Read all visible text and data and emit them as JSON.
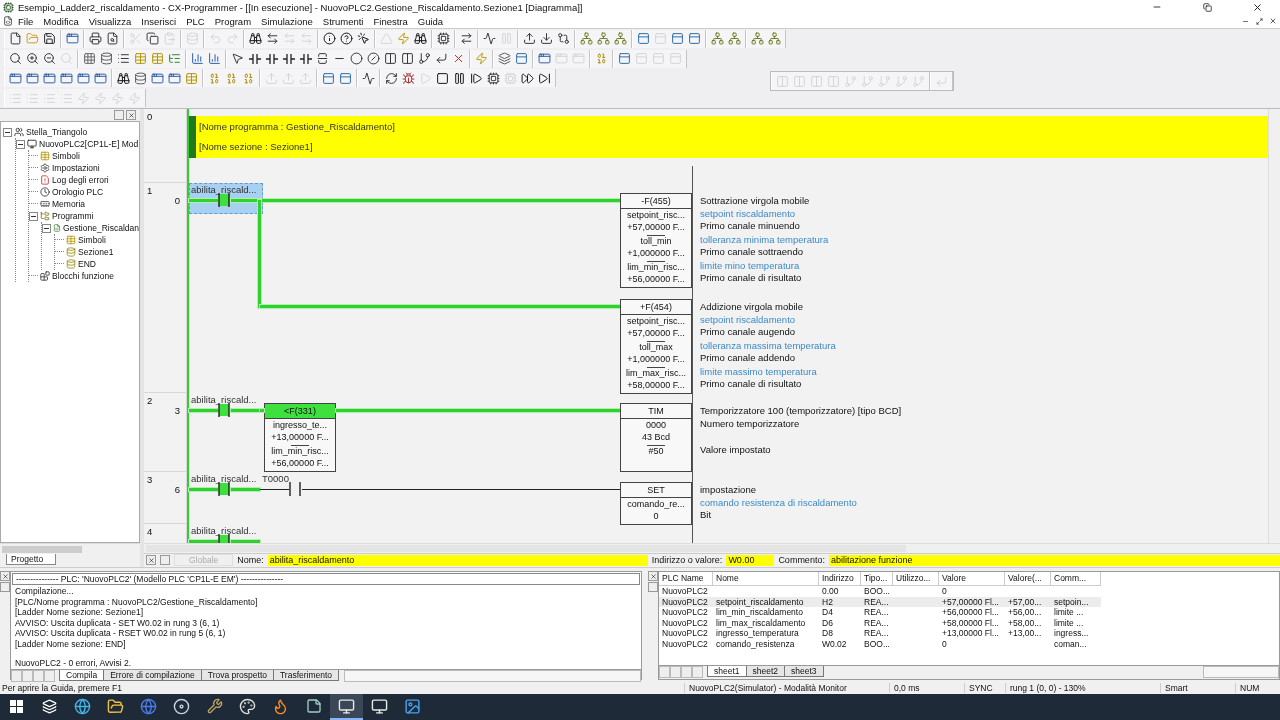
{
  "window": {
    "title": "Esempio_Ladder2_riscaldamento - CX-Programmer - [[In esecuzione] - NuovoPLC2.Gestione_Riscaldamento.Sezione1 [Diagramma]]"
  },
  "menu": [
    "File",
    "Modifica",
    "Visualizza",
    "Inserisci",
    "PLC",
    "Program",
    "Simulazione",
    "Strumenti",
    "Finestra",
    "Guida"
  ],
  "toolbars": [
    {
      "groups": [
        [
          {
            "kind": "new",
            "disabled": false
          },
          {
            "kind": "open",
            "disabled": false
          },
          {
            "kind": "save",
            "disabled": false
          }
        ],
        [
          {
            "kind": "window",
            "disabled": false
          }
        ],
        [
          {
            "kind": "print",
            "disabled": false
          },
          {
            "kind": "preview",
            "disabled": false
          }
        ],
        [
          {
            "kind": "cut",
            "disabled": true
          },
          {
            "kind": "copy",
            "disabled": false
          },
          {
            "kind": "paste",
            "disabled": true
          }
        ],
        [
          {
            "kind": "db",
            "disabled": true
          }
        ],
        [
          {
            "kind": "undo",
            "disabled": true
          },
          {
            "kind": "redo",
            "disabled": true
          }
        ],
        [
          {
            "kind": "find",
            "disabled": false
          },
          {
            "kind": "swap",
            "disabled": false
          },
          {
            "kind": "swap",
            "disabled": true
          },
          {
            "kind": "swap",
            "disabled": true
          }
        ],
        [
          {
            "kind": "info",
            "disabled": false
          },
          {
            "kind": "help",
            "disabled": false
          },
          {
            "kind": "pointerhelp",
            "disabled": false
          }
        ],
        [
          {
            "kind": "warn",
            "disabled": true
          },
          {
            "kind": "bolt",
            "disabled": false
          },
          {
            "kind": "find",
            "disabled": false
          }
        ],
        [
          {
            "kind": "chip",
            "disabled": false
          }
        ],
        [
          {
            "kind": "transfer",
            "disabled": false
          }
        ],
        [
          {
            "kind": "monitor",
            "disabled": false
          },
          {
            "kind": "pause",
            "disabled": true
          }
        ],
        [
          {
            "kind": "upload",
            "disabled": false
          },
          {
            "kind": "download",
            "disabled": false
          },
          {
            "kind": "compare",
            "disabled": false
          }
        ],
        [
          {
            "kind": "net",
            "disabled": false
          },
          {
            "kind": "net",
            "disabled": false
          },
          {
            "kind": "net",
            "disabled": false
          }
        ],
        [
          {
            "kind": "panel",
            "disabled": false
          },
          {
            "kind": "panel",
            "disabled": true
          },
          {
            "kind": "panel",
            "disabled": false
          },
          {
            "kind": "panel",
            "disabled": false
          }
        ],
        [
          {
            "kind": "net",
            "disabled": false
          },
          {
            "kind": "net",
            "disabled": false
          }
        ],
        [
          {
            "kind": "net",
            "disabled": false
          },
          {
            "kind": "net",
            "disabled": false
          }
        ]
      ]
    },
    {
      "groups": [
        [
          {
            "kind": "search",
            "disabled": false
          },
          {
            "kind": "zoomin",
            "disabled": false
          },
          {
            "kind": "zoomout",
            "disabled": false
          },
          {
            "kind": "search",
            "disabled": true
          }
        ],
        [
          {
            "kind": "grid",
            "disabled": false
          },
          {
            "kind": "db",
            "disabled": false
          },
          {
            "kind": "list",
            "disabled": false
          },
          {
            "kind": "table",
            "disabled": false
          },
          {
            "kind": "table",
            "disabled": false
          },
          {
            "kind": "tree",
            "disabled": false
          }
        ],
        [
          {
            "kind": "chart",
            "disabled": false
          },
          {
            "kind": "chart",
            "disabled": false
          }
        ],
        [
          {
            "kind": "pointer",
            "disabled": false
          },
          {
            "kind": "contact",
            "disabled": false
          },
          {
            "kind": "contact",
            "disabled": false
          },
          {
            "kind": "contact",
            "disabled": false
          },
          {
            "kind": "contact",
            "disabled": false
          },
          {
            "kind": "vline",
            "disabled": false
          },
          {
            "kind": "line",
            "disabled": false
          },
          {
            "kind": "coil",
            "disabled": false
          },
          {
            "kind": "coilnc",
            "disabled": false
          },
          {
            "kind": "block",
            "disabled": false
          },
          {
            "kind": "block",
            "disabled": false
          },
          {
            "kind": "branch",
            "disabled": false
          },
          {
            "kind": "corner",
            "disabled": false
          },
          {
            "kind": "del",
            "disabled": false
          }
        ],
        [
          {
            "kind": "bolt",
            "disabled": false
          }
        ],
        [
          {
            "kind": "layers",
            "disabled": false
          },
          {
            "kind": "panel",
            "disabled": false
          }
        ],
        [
          {
            "kind": "window",
            "disabled": false
          },
          {
            "kind": "window",
            "disabled": true
          },
          {
            "kind": "window",
            "disabled": true
          }
        ],
        [
          {
            "kind": "binary",
            "disabled": false
          }
        ],
        [
          {
            "kind": "panel",
            "disabled": false
          },
          {
            "kind": "panel",
            "disabled": true
          },
          {
            "kind": "panel",
            "disabled": true
          },
          {
            "kind": "panel",
            "disabled": true
          }
        ]
      ]
    },
    {
      "groups": [
        [
          {
            "kind": "window",
            "disabled": false
          },
          {
            "kind": "window",
            "disabled": false
          },
          {
            "kind": "window",
            "disabled": false
          },
          {
            "kind": "window",
            "disabled": false
          },
          {
            "kind": "window",
            "disabled": false
          },
          {
            "kind": "window",
            "disabled": false
          }
        ],
        [
          {
            "kind": "find",
            "disabled": false
          },
          {
            "kind": "db",
            "disabled": false
          },
          {
            "kind": "window",
            "disabled": false
          },
          {
            "kind": "window",
            "disabled": false
          },
          {
            "kind": "table",
            "disabled": false
          }
        ],
        [
          {
            "kind": "binary",
            "disabled": false
          },
          {
            "kind": "binary",
            "disabled": false
          },
          {
            "kind": "binary",
            "disabled": false
          }
        ],
        [
          {
            "kind": "upload",
            "disabled": true
          },
          {
            "kind": "upload",
            "disabled": true
          },
          {
            "kind": "upload",
            "disabled": true
          }
        ],
        [
          {
            "kind": "panel",
            "disabled": false
          },
          {
            "kind": "panel",
            "disabled": false
          }
        ],
        [
          {
            "kind": "monitor",
            "disabled": false
          }
        ],
        [
          {
            "kind": "refresh",
            "disabled": false
          },
          {
            "kind": "bug",
            "disabled": false
          },
          {
            "kind": "play",
            "disabled": true
          },
          {
            "kind": "stop",
            "disabled": false
          },
          {
            "kind": "pause",
            "disabled": false
          },
          {
            "kind": "step",
            "disabled": false
          },
          {
            "kind": "chip",
            "disabled": false
          },
          {
            "kind": "chip",
            "disabled": true
          },
          {
            "kind": "ff",
            "disabled": false
          },
          {
            "kind": "skip",
            "disabled": false
          }
        ]
      ]
    },
    {
      "groups": [
        [
          {
            "kind": "list",
            "disabled": true
          },
          {
            "kind": "list",
            "disabled": true
          },
          {
            "kind": "list",
            "disabled": true
          },
          {
            "kind": "list",
            "disabled": true
          },
          {
            "kind": "bolt",
            "disabled": true
          },
          {
            "kind": "bolt",
            "disabled": true
          },
          {
            "kind": "bolt",
            "disabled": true
          },
          {
            "kind": "bolt",
            "disabled": true
          }
        ]
      ]
    }
  ],
  "floating_toolbar": {
    "groups": [
      [
        {
          "kind": "block",
          "disabled": true
        },
        {
          "kind": "block",
          "disabled": true
        },
        {
          "kind": "block",
          "disabled": true
        },
        {
          "kind": "block",
          "disabled": true
        },
        {
          "kind": "branch",
          "disabled": true
        },
        {
          "kind": "branch",
          "disabled": true
        },
        {
          "kind": "branch",
          "disabled": true
        },
        {
          "kind": "branch",
          "disabled": true
        },
        {
          "kind": "branch",
          "disabled": true
        }
      ],
      [
        {
          "kind": "corner",
          "disabled": true
        }
      ]
    ]
  },
  "tree": {
    "items": [
      {
        "label": "Stella_Triangolo",
        "kind": "project",
        "expanded": true,
        "children": [
          {
            "label": "NuovoPLC2[CP1L-E] Mod",
            "kind": "plc",
            "expanded": true,
            "children": [
              {
                "label": "Simboli",
                "kind": "symbols"
              },
              {
                "label": "Impostazioni",
                "kind": "settings"
              },
              {
                "label": "Log degli errori",
                "kind": "errorlog"
              },
              {
                "label": "Orologio PLC",
                "kind": "clock"
              },
              {
                "label": "Memoria",
                "kind": "memory"
              },
              {
                "label": "Programmi",
                "kind": "programs",
                "expanded": true,
                "children": [
                  {
                    "label": "Gestione_Riscaldan",
                    "kind": "program",
                    "expanded": true,
                    "children": [
                      {
                        "label": "Simboli",
                        "kind": "symbols"
                      },
                      {
                        "label": "Sezione1",
                        "kind": "section"
                      },
                      {
                        "label": "END",
                        "kind": "section"
                      }
                    ]
                  }
                ]
              },
              {
                "label": "Blocchi funzione",
                "kind": "blocks"
              }
            ]
          }
        ]
      }
    ]
  },
  "project_tab": "Progetto",
  "ladder": {
    "rungs": [
      {
        "kind": "comment",
        "number": "0",
        "lines": [
          "[Nome programma : Gestione_Riscaldamento]",
          "[Nome sezione : Sezione1]"
        ]
      },
      {
        "kind": "logic",
        "number": "1",
        "step": "0",
        "contacts": [
          {
            "label": "abilita_riscald...",
            "powered": true,
            "selected": true
          }
        ],
        "instructions": [
          {
            "name": "-F(455)",
            "title": "Sottrazione virgola mobile",
            "operands": [
              {
                "symbol": "setpoint_risc...",
                "value": "+57,00000 F...",
                "comment": "setpoint riscaldamento",
                "desc": "Primo canale minuendo"
              },
              {
                "symbol": "toll_min",
                "value": "+1,000000 F...",
                "comment": "tolleranza minima temperatura",
                "desc": "Primo canale sottraendo"
              },
              {
                "symbol": "lim_min_risc...",
                "value": "+56,00000 F...",
                "comment": "limite mino temperatura",
                "desc": "Primo canale di risultato"
              }
            ]
          },
          {
            "name": "+F(454)",
            "title": "Addizione virgola mobile",
            "operands": [
              {
                "symbol": "setpoint_risc...",
                "value": "+57,00000 F...",
                "comment": "setpoint riscaldamento",
                "desc": "Primo canale augendo"
              },
              {
                "symbol": "toll_max",
                "value": "+1,000000 F...",
                "comment": "tolleranza massima temperatura",
                "desc": "Primo canale addendo"
              },
              {
                "symbol": "lim_max_risc...",
                "value": "+58,00000 F...",
                "comment": "limite massimo temperatura",
                "desc": "Primo canale di risultato"
              }
            ]
          }
        ]
      },
      {
        "kind": "logic",
        "number": "2",
        "step": "3",
        "contacts": [
          {
            "label": "abilita_riscald...",
            "powered": true,
            "selected": false
          }
        ],
        "compare": {
          "name": "<F(331)",
          "powered": true,
          "operands": [
            {
              "symbol": "ingresso_te...",
              "value": "+13,00000 F..."
            },
            {
              "symbol": "lim_min_risc...",
              "value": "+56,00000 F..."
            }
          ]
        },
        "instructions": [
          {
            "name": "TIM",
            "title": "Temporizzatore 100 (temporizzatore) [tipo BCD]",
            "operands": [
              {
                "symbol": "0000",
                "value": "43 Bcd",
                "desc": "Numero temporizzatore"
              },
              {
                "symbol": "#50",
                "desc": "Valore impostato"
              }
            ]
          }
        ]
      },
      {
        "kind": "logic",
        "number": "3",
        "step": "6",
        "contacts": [
          {
            "label": "abilita_riscald...",
            "powered": true,
            "selected": false
          },
          {
            "label": "T0000",
            "powered": false,
            "selected": false
          }
        ],
        "instructions": [
          {
            "name": "SET",
            "title": "impostazione",
            "operands": [
              {
                "symbol": "comando_re...",
                "value": "0",
                "comment": "comando resistenza di riscaldamento",
                "desc": "Bit"
              }
            ]
          }
        ]
      },
      {
        "kind": "logic",
        "number": "4",
        "contacts": [
          {
            "label": "abilita_riscald...",
            "powered": true,
            "selected": false
          }
        ]
      }
    ]
  },
  "symbol_bar": {
    "scope": "Globale",
    "name_label": "Nome:",
    "name": "abilita_riscaldamento",
    "address_label": "Indirizzo o valore:",
    "address": "W0.00",
    "comment_label": "Commento:",
    "comment": "abilitazione funzione"
  },
  "output": {
    "header": "--------------- PLC: 'NuovoPLC2' (Modello PLC 'CP1L-E EM') ---------------",
    "lines": [
      "Compilazione...",
      "[PLC/Nome programma : NuovoPLC2/Gestione_Riscaldamento]",
      "[Ladder Nome sezione: Sezione1]",
      "AVVISO: Uscita duplicata -  SET W0.02 in rung 3 (6, 1)",
      "AVVISO: Uscita duplicata -  RSET W0.02 in rung 5 (6, 1)",
      "[Ladder Nome sezione: END]"
    ],
    "summary": "NuovoPLC2 - 0 errori, Avvisi 2.",
    "tabs": [
      {
        "label": "Compila",
        "selected": true
      },
      {
        "label": "Errore di compilazione",
        "selected": false
      },
      {
        "label": "Trova prospetto",
        "selected": false
      },
      {
        "label": "Trasferimento",
        "selected": false
      }
    ]
  },
  "watch": {
    "columns": [
      "PLC Name",
      "Nome",
      "Indirizzo",
      "Tipo...",
      "Utilizzo...",
      "Valore",
      "Valore(...",
      "Comm..."
    ],
    "rows": [
      {
        "plc": "NuovoPLC2",
        "address": "0.00",
        "type": "BOO...",
        "value": "0",
        "selected": false
      },
      {
        "plc": "NuovoPLC2",
        "name": "setpoint_riscaldamento",
        "address": "H2",
        "type": "REA...",
        "value": "+57,00000 Fl...",
        "value2": "+57,00...",
        "comment": "setpoin...",
        "selected": true
      },
      {
        "plc": "NuovoPLC2",
        "name": "lim_min_riscaldamento",
        "address": "D4",
        "type": "REA...",
        "value": "+56,00000 Fl...",
        "value2": "+56,00...",
        "comment": "limite ...",
        "selected": false
      },
      {
        "plc": "NuovoPLC2",
        "name": "lim_max_riscaldamento",
        "address": "D6",
        "type": "REA...",
        "value": "+58,00000 Fl...",
        "value2": "+58,00...",
        "comment": "limite ...",
        "selected": false
      },
      {
        "plc": "NuovoPLC2",
        "name": "ingresso_temperatura",
        "address": "D8",
        "type": "REA...",
        "value": "+13,00000 Fl...",
        "value2": "+13,00...",
        "comment": "ingress...",
        "selected": false
      },
      {
        "plc": "NuovoPLC2",
        "name": "comando_resistenza",
        "address": "W0.02",
        "type": "BOO...",
        "value": "0",
        "comment": "coman...",
        "selected": false
      }
    ],
    "tabs": [
      {
        "label": "sheet1",
        "selected": true
      },
      {
        "label": "sheet2",
        "selected": false
      },
      {
        "label": "sheet3",
        "selected": false
      }
    ]
  },
  "status_bar": {
    "help": "Per aprire la Guida, premere F1",
    "fields": [
      "NuovoPLC2(Simulator) - Modalità Monitor",
      "0,0 ms",
      "SYNC",
      "rung 1 (0, 0) - 130%",
      "Smart",
      "NUM"
    ]
  },
  "taskbar": [
    {
      "kind": "start",
      "active": false
    },
    {
      "kind": "taskview",
      "active": false
    },
    {
      "kind": "browser",
      "active": false
    },
    {
      "kind": "folder",
      "active": false
    },
    {
      "kind": "globe",
      "active": false
    },
    {
      "kind": "disc",
      "active": false
    },
    {
      "kind": "tool",
      "active": false
    },
    {
      "kind": "palette",
      "active": false
    },
    {
      "kind": "fire",
      "active": false
    },
    {
      "kind": "notes",
      "active": false
    },
    {
      "kind": "app",
      "active": true
    },
    {
      "kind": "app",
      "active": false
    },
    {
      "kind": "image",
      "active": false
    }
  ]
}
